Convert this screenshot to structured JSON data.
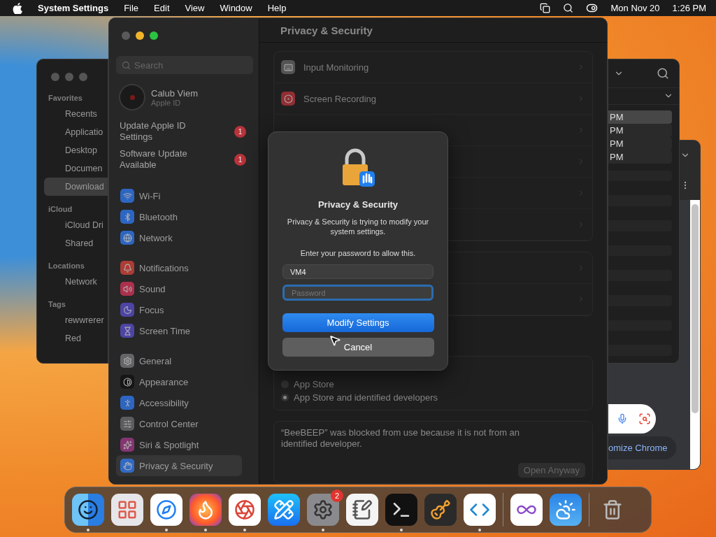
{
  "menu_bar": {
    "app_name": "System Settings",
    "menus": [
      "File",
      "Edit",
      "View",
      "Window",
      "Help"
    ],
    "date": "Mon Nov 20",
    "time": "1:26 PM"
  },
  "finder": {
    "sections": [
      {
        "title": "Favorites",
        "items": [
          {
            "label": "Recents",
            "selected": false
          },
          {
            "label": "Applicatio",
            "selected": false
          },
          {
            "label": "Desktop",
            "selected": false
          },
          {
            "label": "Documen",
            "selected": false
          },
          {
            "label": "Download",
            "selected": true
          }
        ]
      },
      {
        "title": "iCloud",
        "items": [
          {
            "label": "iCloud Dri",
            "selected": false
          },
          {
            "label": "Shared",
            "selected": false
          }
        ]
      },
      {
        "title": "Locations",
        "items": [
          {
            "label": "Network",
            "selected": false
          }
        ]
      },
      {
        "title": "Tags",
        "items": [
          {
            "label": "rewwrerer",
            "selected": false
          },
          {
            "label": "Red",
            "selected": false
          }
        ]
      }
    ]
  },
  "list_window": {
    "rows": [
      {
        "text": "PM",
        "selected": true
      },
      {
        "text": "PM",
        "selected": false
      },
      {
        "text": "PM",
        "selected": false
      },
      {
        "text": "PM",
        "selected": false
      }
    ]
  },
  "chrome_window": {
    "button": "omize Chrome"
  },
  "settings": {
    "title": "Privacy & Security",
    "search": {
      "placeholder": "Search"
    },
    "account": {
      "name": "Calub Viem",
      "subtitle": "Apple ID"
    },
    "alerts": [
      {
        "label": "Update Apple ID Settings",
        "badge": "1"
      },
      {
        "label": "Software Update Available",
        "badge": "1"
      }
    ],
    "groups": [
      {
        "items": [
          {
            "kind": "wifi",
            "label": "Wi-Fi",
            "selected": false
          },
          {
            "kind": "bluetooth",
            "label": "Bluetooth",
            "selected": false
          },
          {
            "kind": "network",
            "label": "Network",
            "selected": false
          }
        ]
      },
      {
        "items": [
          {
            "kind": "notifications",
            "label": "Notifications",
            "selected": false
          },
          {
            "kind": "sound",
            "label": "Sound",
            "selected": false
          },
          {
            "kind": "focus",
            "label": "Focus",
            "selected": false
          },
          {
            "kind": "screentime",
            "label": "Screen Time",
            "selected": false
          }
        ]
      },
      {
        "items": [
          {
            "kind": "general",
            "label": "General",
            "selected": false
          },
          {
            "kind": "appearance",
            "label": "Appearance",
            "selected": false
          },
          {
            "kind": "accessibility",
            "label": "Accessibility",
            "selected": false
          },
          {
            "kind": "controlcenter",
            "label": "Control Center",
            "selected": false
          },
          {
            "kind": "siri",
            "label": "Siri & Spotlight",
            "selected": false
          },
          {
            "kind": "privacy",
            "label": "Privacy & Security",
            "selected": true
          }
        ]
      }
    ],
    "privacy_rows": [
      {
        "kind": "input",
        "label": "Input Monitoring"
      },
      {
        "kind": "recording",
        "label": "Screen Recording"
      }
    ],
    "allow_options": [
      {
        "label": "App Store",
        "selected": false
      },
      {
        "label": "App Store and identified developers",
        "selected": true
      }
    ],
    "blocked_message": "“BeeBEEP” was blocked from use because it is not from an identified developer.",
    "open_button": "Open Anyway"
  },
  "dialog": {
    "title": "Privacy & Security",
    "message": "Privacy & Security is trying to modify your system settings.",
    "prompt": "Enter your password to allow this.",
    "username": "VM4",
    "password_placeholder": "Password",
    "primary": "Modify Settings",
    "cancel": "Cancel"
  },
  "dock": {
    "groups": [
      {
        "items": [
          {
            "kind": "finder",
            "running": true
          },
          {
            "kind": "launchpad",
            "running": false
          },
          {
            "kind": "safari",
            "running": true
          },
          {
            "kind": "firefox",
            "running": true
          },
          {
            "kind": "chrome",
            "running": true
          },
          {
            "kind": "appstore",
            "running": false
          },
          {
            "kind": "settings",
            "running": true,
            "badge": "2"
          },
          {
            "kind": "textedit",
            "running": false
          },
          {
            "kind": "terminal",
            "running": true
          },
          {
            "kind": "garageband",
            "running": false
          },
          {
            "kind": "vscode",
            "running": true
          }
        ]
      },
      {
        "items": [
          {
            "kind": "visualstudio",
            "running": false
          },
          {
            "kind": "weather",
            "running": false
          }
        ]
      },
      {
        "items": [
          {
            "kind": "trash",
            "running": false
          }
        ]
      }
    ]
  }
}
